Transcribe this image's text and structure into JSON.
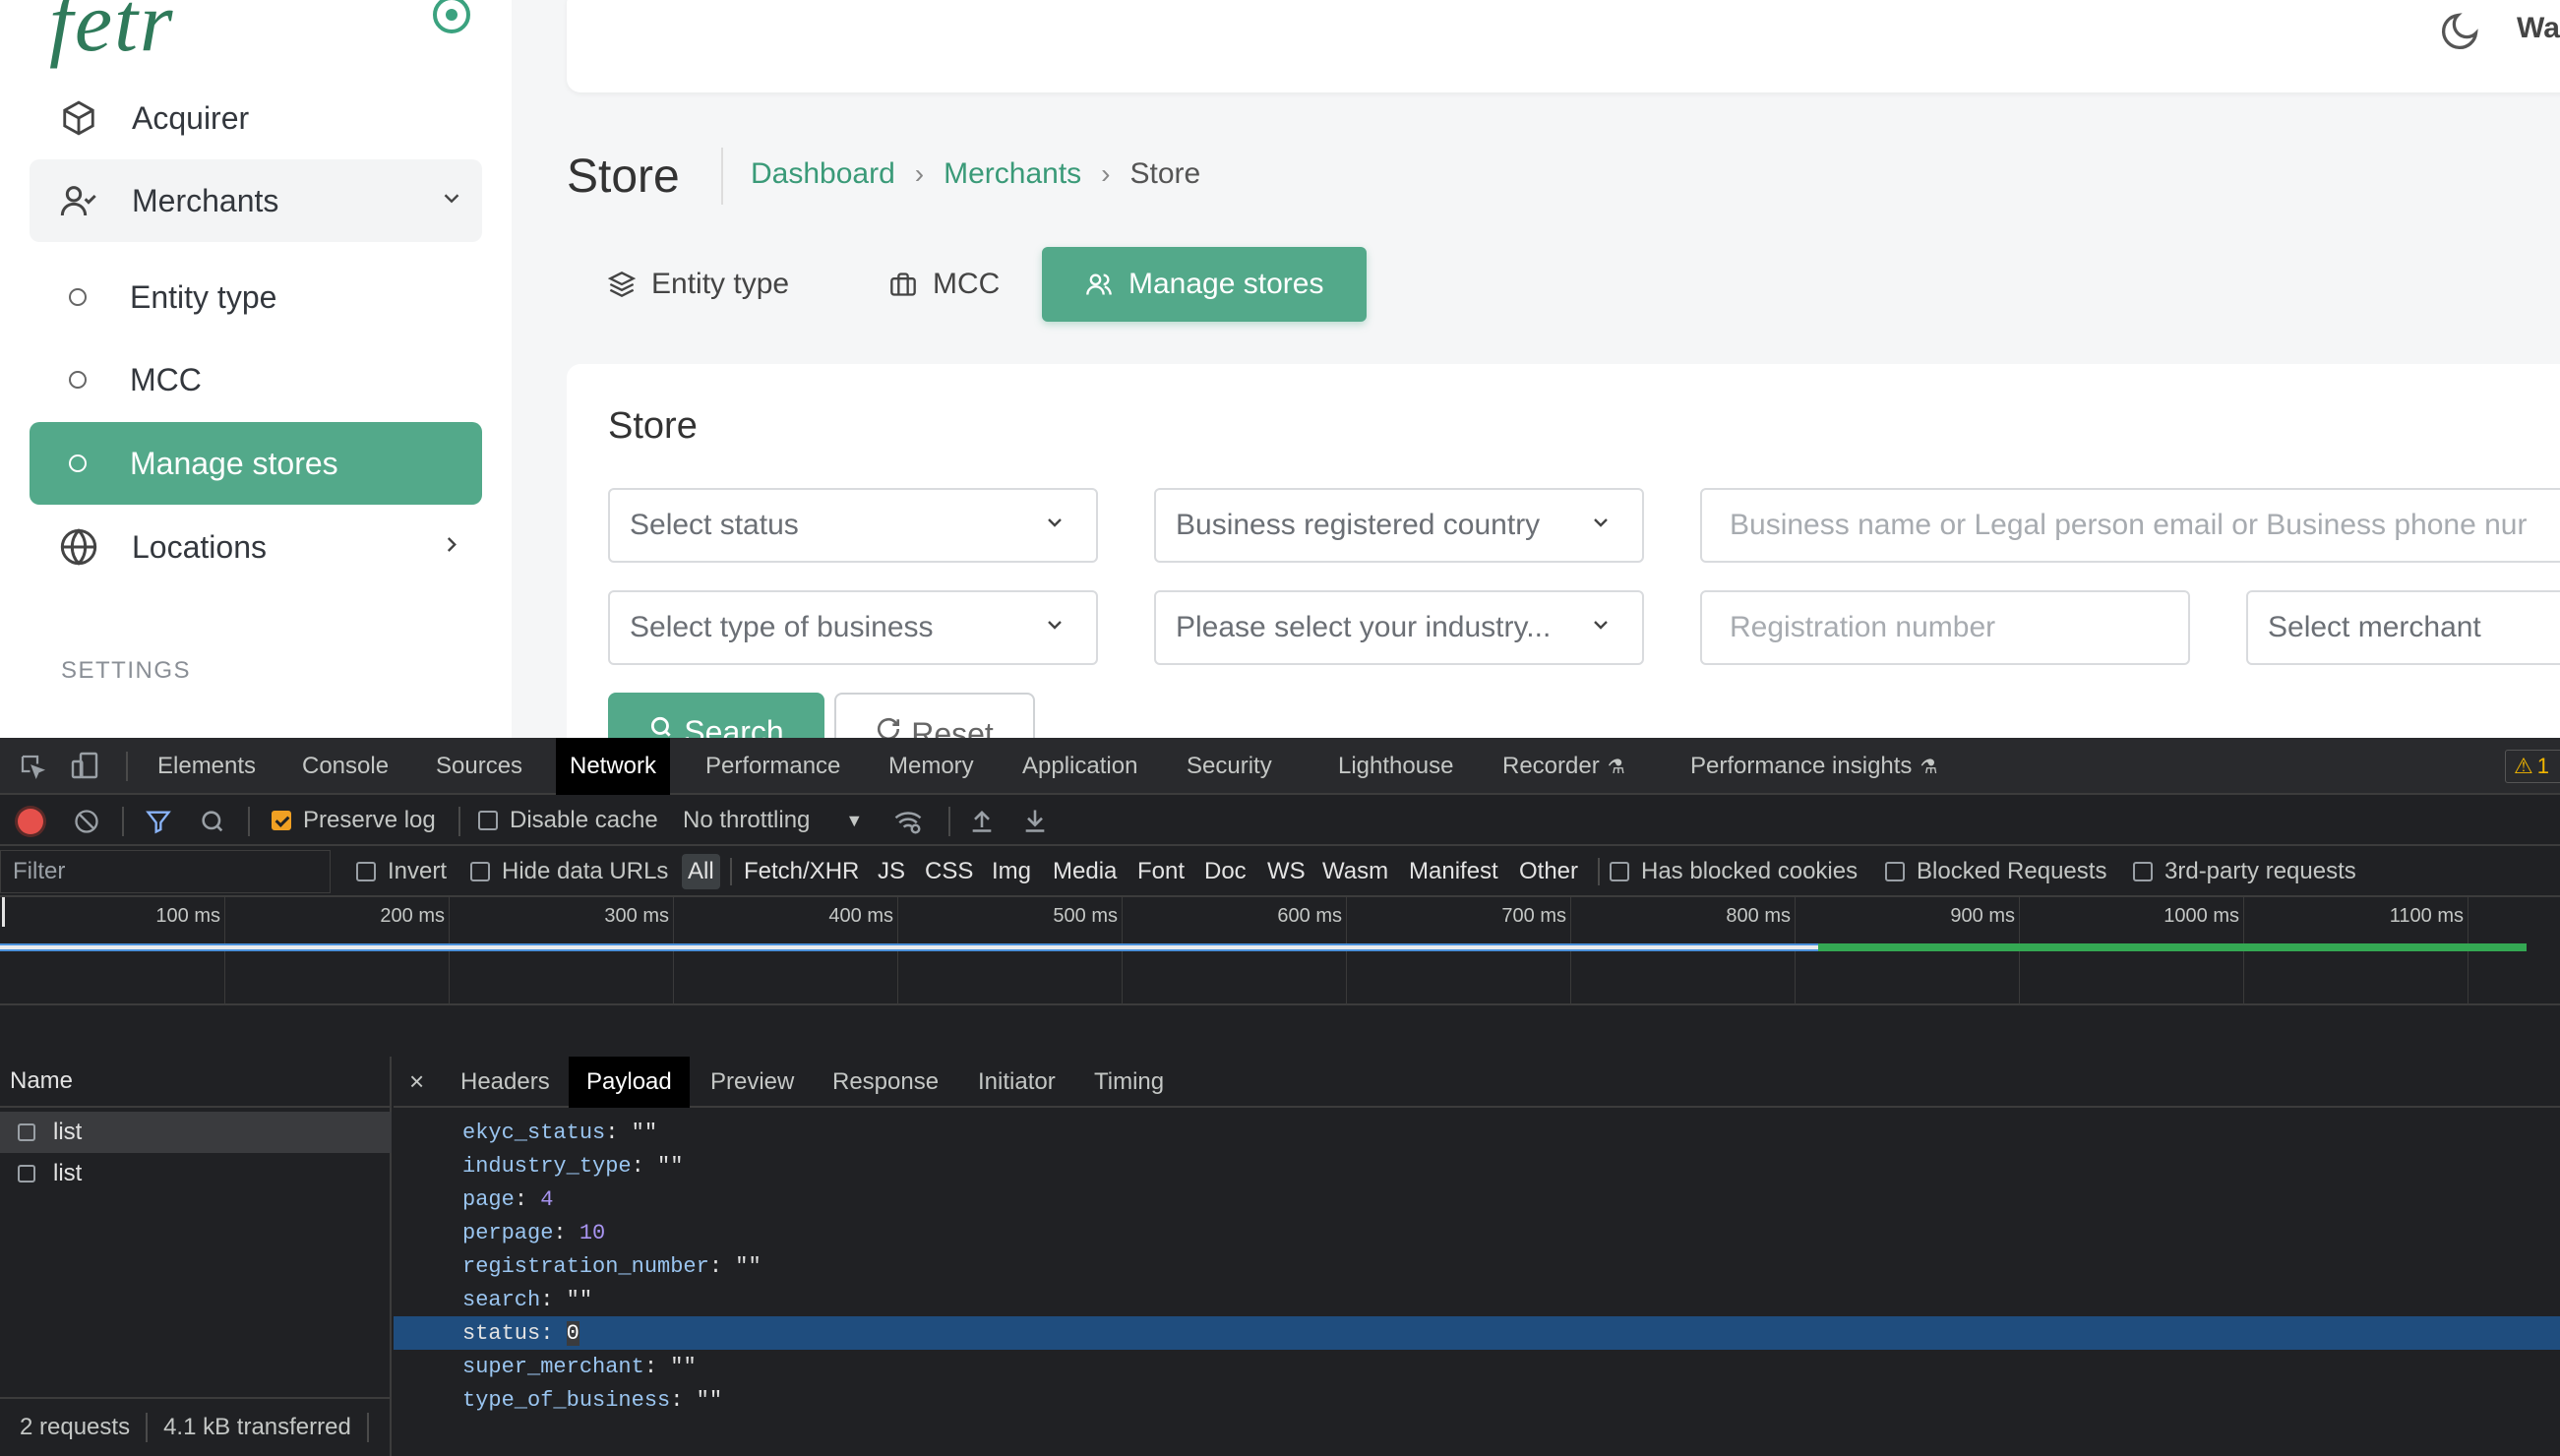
{
  "app": {
    "logo_text": "fetr",
    "sidebar": {
      "items": [
        {
          "label": "Acquirer",
          "icon": "box-icon"
        },
        {
          "label": "Merchants",
          "icon": "user-check-icon"
        },
        {
          "label": "Entity type"
        },
        {
          "label": "MCC"
        },
        {
          "label": "Manage stores"
        },
        {
          "label": "Locations",
          "icon": "globe-icon"
        }
      ],
      "settings_label": "SETTINGS"
    },
    "header": {
      "user_name_truncated": "Wa"
    },
    "page_title": "Store",
    "breadcrumb": [
      "Dashboard",
      "Merchants",
      "Store"
    ],
    "tabs": [
      {
        "label": "Entity type",
        "icon": "layers-icon"
      },
      {
        "label": "MCC",
        "icon": "briefcase-icon"
      },
      {
        "label": "Manage stores",
        "icon": "users-icon",
        "active": true
      }
    ],
    "card_title": "Store",
    "filters": {
      "status_placeholder": "Select status",
      "country_placeholder": "Business registered country",
      "search_placeholder": "Business name or Legal person email or Business phone nur",
      "business_type_placeholder": "Select type of business",
      "industry_placeholder": "Please select your industry...",
      "registration_placeholder": "Registration number",
      "merchant_placeholder": "Select merchant"
    },
    "search_label": "Search",
    "reset_label": "Reset",
    "colors": {
      "accent": "#53a98a",
      "link": "#3a9a78"
    }
  },
  "devtools": {
    "tabs": [
      "Elements",
      "Console",
      "Sources",
      "Network",
      "Performance",
      "Memory",
      "Application",
      "Security",
      "Lighthouse",
      "Recorder",
      "Performance insights"
    ],
    "active_tab": "Network",
    "warning_count": "1",
    "toolbar": {
      "preserve_log": "Preserve log",
      "disable_cache": "Disable cache",
      "throttling": "No throttling"
    },
    "filter": {
      "placeholder": "Filter",
      "invert": "Invert",
      "hide_data_urls": "Hide data URLs",
      "types": [
        "All",
        "Fetch/XHR",
        "JS",
        "CSS",
        "Img",
        "Media",
        "Font",
        "Doc",
        "WS",
        "Wasm",
        "Manifest",
        "Other"
      ],
      "has_blocked_cookies": "Has blocked cookies",
      "blocked_requests": "Blocked Requests",
      "third_party": "3rd-party requests"
    },
    "timeline": {
      "ticks": [
        "100 ms",
        "200 ms",
        "300 ms",
        "400 ms",
        "500 ms",
        "600 ms",
        "700 ms",
        "800 ms",
        "900 ms",
        "1000 ms",
        "1100 ms"
      ]
    },
    "name_header": "Name",
    "requests": [
      "list",
      "list"
    ],
    "status": {
      "requests": "2 requests",
      "transferred": "4.1 kB transferred"
    },
    "detail_tabs": [
      "Headers",
      "Payload",
      "Preview",
      "Response",
      "Initiator",
      "Timing"
    ],
    "active_detail_tab": "Payload",
    "payload": [
      {
        "key": "ekyc_status",
        "value": "\"\"",
        "type": "str"
      },
      {
        "key": "industry_type",
        "value": "\"\"",
        "type": "str"
      },
      {
        "key": "page",
        "value": "4",
        "type": "num"
      },
      {
        "key": "perpage",
        "value": "10",
        "type": "num"
      },
      {
        "key": "registration_number",
        "value": "\"\"",
        "type": "str"
      },
      {
        "key": "search",
        "value": "\"\"",
        "type": "str"
      },
      {
        "key": "status",
        "value": "0",
        "type": "num",
        "selected": true
      },
      {
        "key": "super_merchant",
        "value": "\"\"",
        "type": "str"
      },
      {
        "key": "type_of_business",
        "value": "\"\"",
        "type": "str"
      }
    ]
  }
}
